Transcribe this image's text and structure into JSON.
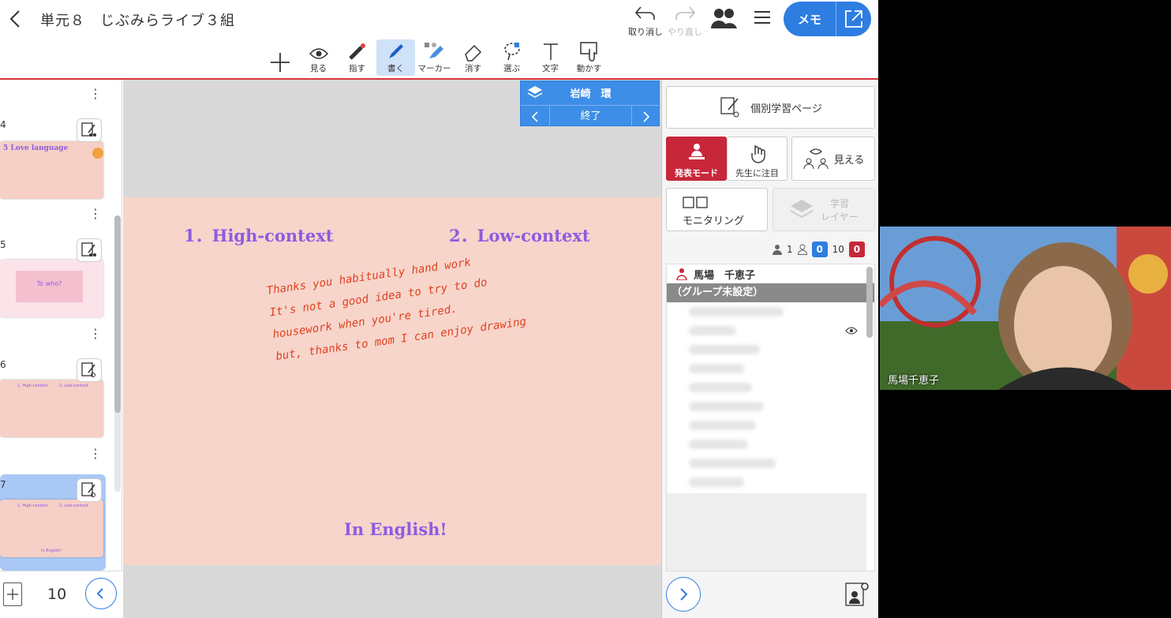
{
  "header": {
    "title": "単元８　じぶみらライブ３組",
    "undo_label": "取り消し",
    "redo_label": "やり直し",
    "memo_label": "メモ"
  },
  "toolbar": {
    "tools": [
      {
        "label": ""
      },
      {
        "label": "見る"
      },
      {
        "label": "指す"
      },
      {
        "label": "書く"
      },
      {
        "label": "マーカー"
      },
      {
        "label": "消す"
      },
      {
        "label": "選ぶ"
      },
      {
        "label": "文字"
      },
      {
        "label": "動かす"
      }
    ],
    "active_tool": "書く"
  },
  "thumbnails": [
    {
      "num": "4",
      "title": "5 Love language"
    },
    {
      "num": "5",
      "title": "To who?"
    },
    {
      "num": "6",
      "col1": "1. High-context",
      "col2": "2. Low-context"
    },
    {
      "num": "7",
      "col1": "1. High-context",
      "col2": "2. Low-context",
      "foot": "In English!"
    }
  ],
  "left_footer": {
    "page_count": "10"
  },
  "layer_box": {
    "student_name": "岩崎　環",
    "end_label": "終了"
  },
  "slide": {
    "heading1": "1．High-context",
    "heading2": "2．Low-context",
    "handwriting": [
      "Thanks you habitually hand work",
      "It's not a good idea to try to do",
      "housework when you're tired.",
      "but, thanks to mom I can enjoy drawing"
    ],
    "footer": "In English!"
  },
  "right_panel": {
    "individual_page_label": "個別学習ページ",
    "present_mode_label": "発表モード",
    "attention_label": "先生に注目",
    "visible_label": "見える",
    "monitoring_label": "モニタリング",
    "study_layer_label": "学習\nレイヤー",
    "counts": {
      "teacher": "1",
      "blue": "0",
      "students": "10",
      "red": "0"
    },
    "teacher_name": "馬場　千恵子",
    "group_label": "（グループ未設定）"
  },
  "video": {
    "caption": "馬場千恵子"
  },
  "colors": {
    "accent": "#2e7de1",
    "present": "#c8273a",
    "slide_bg": "#f7d5cb",
    "heading": "#8d5ce0",
    "ink": "#e04020"
  }
}
